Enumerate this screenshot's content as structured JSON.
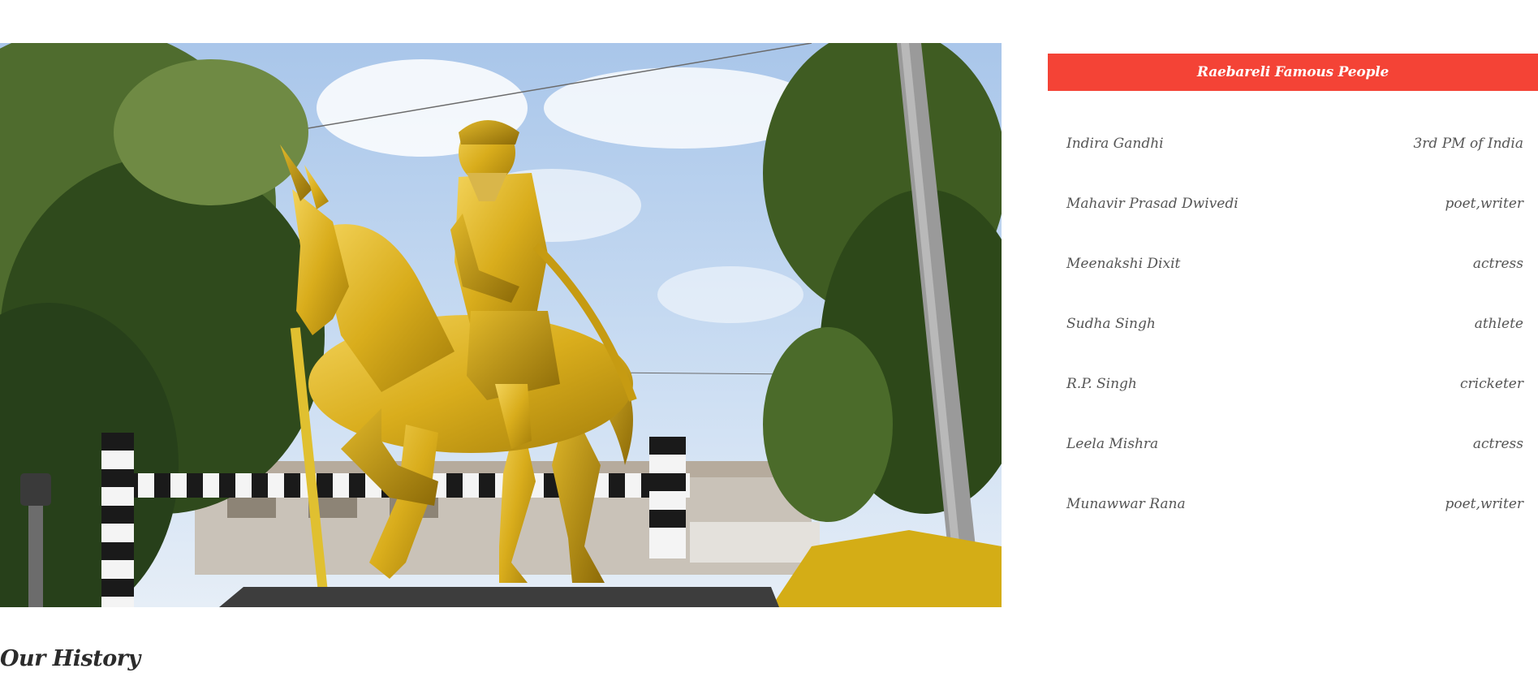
{
  "hero": {
    "image_alt": "Golden equestrian statue",
    "icon": "statue-photo"
  },
  "famous_people": {
    "title": "Raebareli Famous People",
    "accent_color": "#f44336",
    "people": [
      {
        "name": "Indira Gandhi",
        "role": "3rd PM of India"
      },
      {
        "name": "Mahavir Prasad Dwivedi",
        "role": "poet,writer"
      },
      {
        "name": "Meenakshi Dixit",
        "role": "actress"
      },
      {
        "name": "Sudha Singh",
        "role": "athlete"
      },
      {
        "name": "R.P. Singh",
        "role": "cricketer"
      },
      {
        "name": "Leela Mishra",
        "role": "actress"
      },
      {
        "name": "Munawwar Rana",
        "role": "poet,writer"
      }
    ]
  },
  "history": {
    "title": "Our History"
  }
}
